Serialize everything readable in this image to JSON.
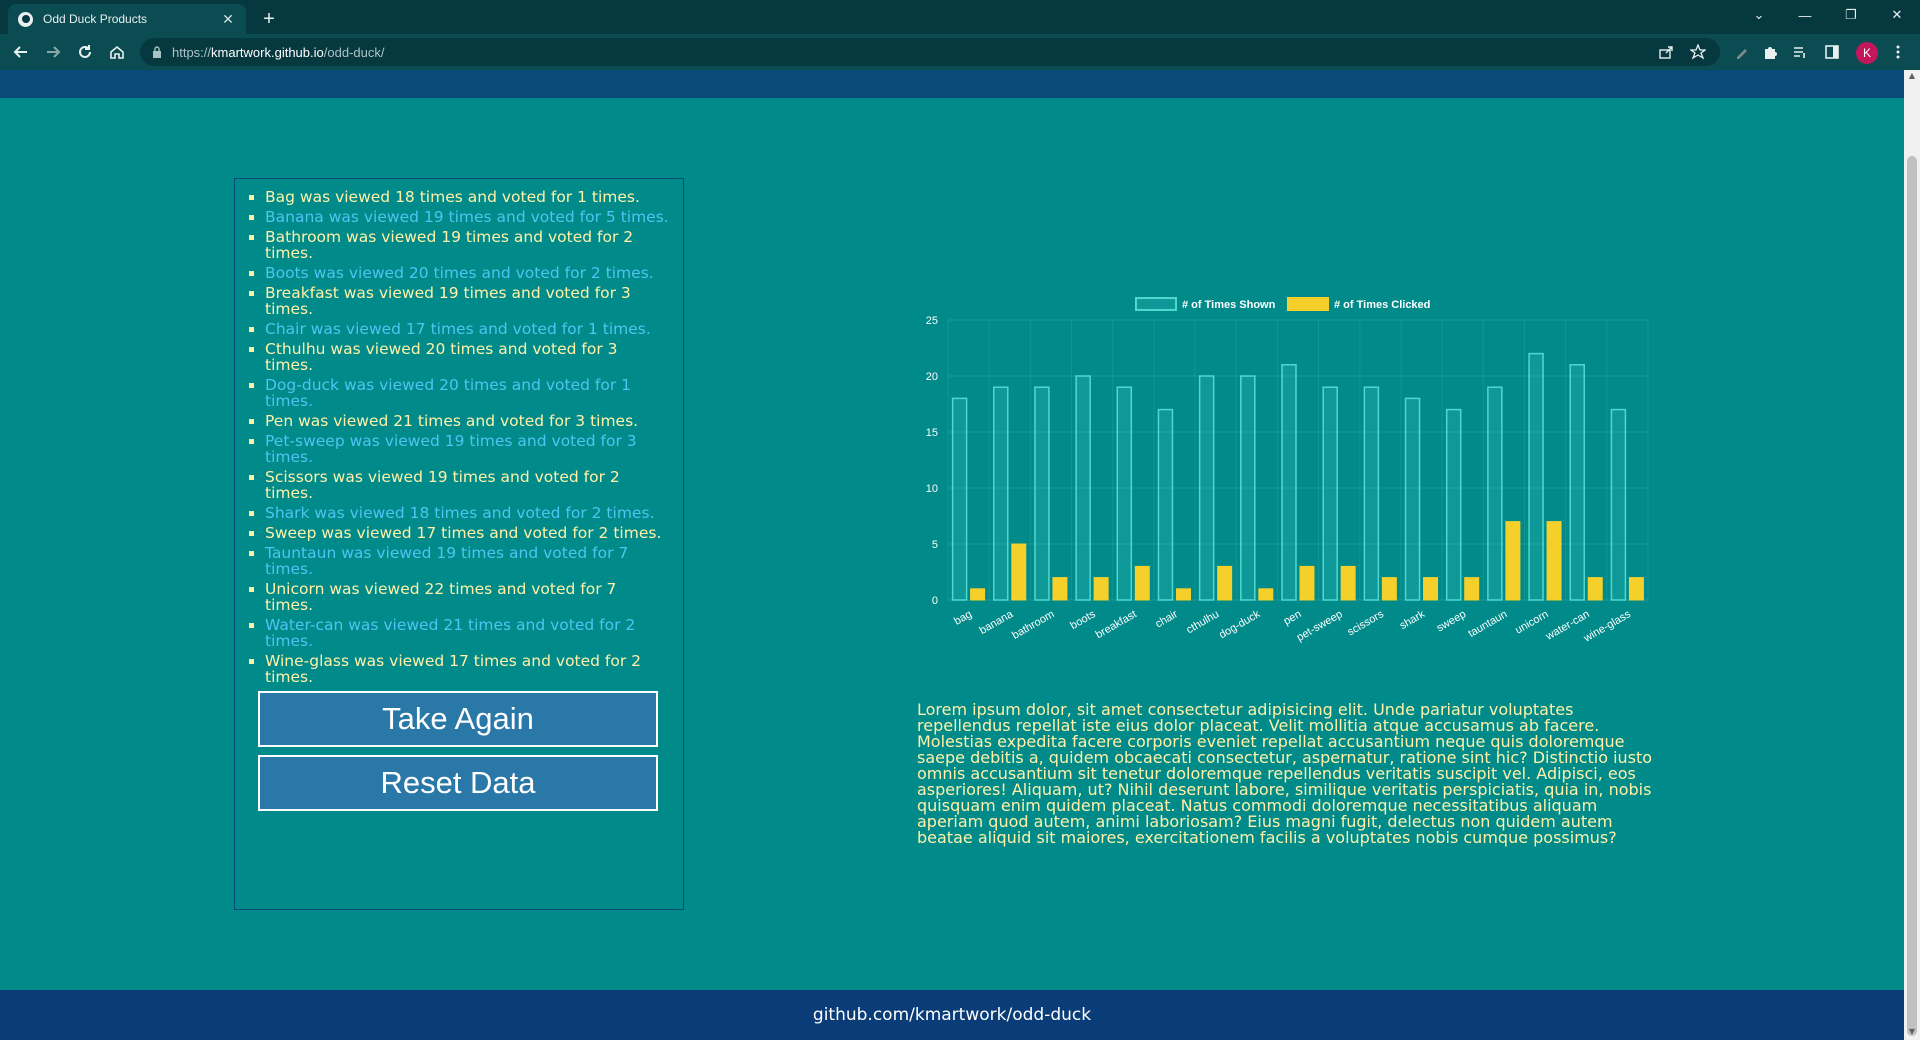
{
  "browser": {
    "tab_title": "Odd Duck Products",
    "url_scheme": "https://",
    "url_host": "kmartwork.github.io",
    "url_path": "/odd-duck/",
    "profile_initial": "K"
  },
  "results": {
    "items": [
      "Bag was viewed 18 times and voted for 1 times.",
      "Banana was viewed 19 times and voted for 5 times.",
      "Bathroom was viewed 19 times and voted for 2 times.",
      "Boots was viewed 20 times and voted for 2 times.",
      "Breakfast was viewed 19 times and voted for 3 times.",
      "Chair was viewed 17 times and voted for 1 times.",
      "Cthulhu was viewed 20 times and voted for 3 times.",
      "Dog-duck was viewed 20 times and voted for 1 times.",
      "Pen was viewed 21 times and voted for 3 times.",
      "Pet-sweep was viewed 19 times and voted for 3 times.",
      "Scissors was viewed 19 times and voted for 2 times.",
      "Shark was viewed 18 times and voted for 2 times.",
      "Sweep was viewed 17 times and voted for 2 times.",
      "Tauntaun was viewed 19 times and voted for 7 times.",
      "Unicorn was viewed 22 times and voted for 7 times.",
      "Water-can was viewed 21 times and voted for 2 times.",
      "Wine-glass was viewed 17 times and voted for 2 times."
    ],
    "take_again_label": "Take Again",
    "reset_label": "Reset Data"
  },
  "chart_data": {
    "type": "bar",
    "categories": [
      "bag",
      "banana",
      "bathroom",
      "boots",
      "breakfast",
      "chair",
      "cthulhu",
      "dog-duck",
      "pen",
      "pet-sweep",
      "scissors",
      "shark",
      "sweep",
      "tauntaun",
      "unicorn",
      "water-can",
      "wine-glass"
    ],
    "series": [
      {
        "name": "# of Times Shown",
        "values": [
          18,
          19,
          19,
          20,
          19,
          17,
          20,
          20,
          21,
          19,
          19,
          18,
          17,
          19,
          22,
          21,
          17
        ],
        "color": "#4ed8d0"
      },
      {
        "name": "# of Times Clicked",
        "values": [
          1,
          5,
          2,
          2,
          3,
          1,
          3,
          1,
          3,
          3,
          2,
          2,
          2,
          7,
          7,
          2,
          2
        ],
        "color": "#f5d02a"
      }
    ],
    "y_ticks": [
      0,
      5,
      10,
      15,
      20,
      25
    ],
    "ylim": [
      0,
      25
    ],
    "legend_position": "top",
    "grid": true
  },
  "lorem": "Lorem ipsum dolor, sit amet consectetur adipisicing elit. Unde pariatur voluptates repellendus repellat iste eius dolor placeat. Velit mollitia atque accusamus ab facere. Molestias expedita facere corporis eveniet repellat accusantium neque quis doloremque saepe debitis a, quidem obcaecati consectetur, aspernatur, ratione sint hic? Distinctio iusto omnis accusantium sit tenetur doloremque repellendus veritatis suscipit vel. Adipisci, eos asperiores! Aliquam, ut? Nihil deserunt labore, similique veritatis perspiciatis, quia in, nobis quisquam enim quidem placeat. Natus commodi doloremque necessitatibus aliquam aperiam quod autem, animi laboriosam? Eius magni fugit, delectus non quidem autem beatae aliquid sit maiores, exercitationem facilis a voluptates nobis cumque possimus?",
  "footer": {
    "link_text": "github.com/kmartwork/odd-duck"
  }
}
